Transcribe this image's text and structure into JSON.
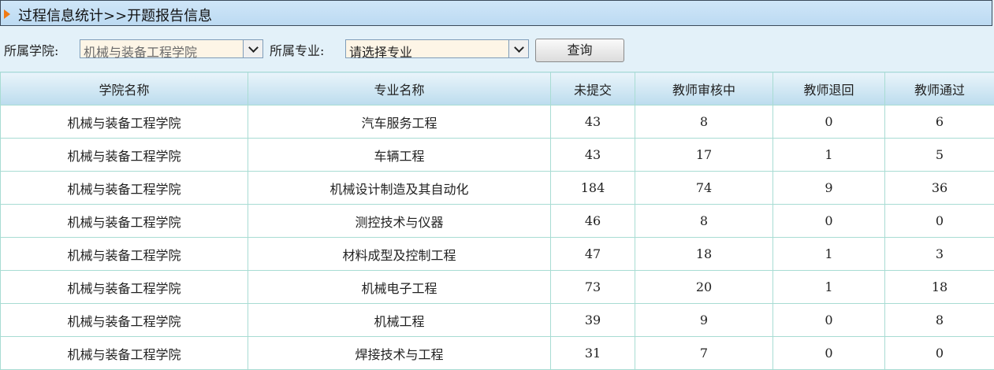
{
  "header": {
    "title": "过程信息统计>>开题报告信息"
  },
  "filters": {
    "college_label": "所属学院:",
    "college_value": "机械与装备工程学院",
    "major_label": "所属专业:",
    "major_value": "请选择专业",
    "query_label": "查询"
  },
  "table": {
    "columns": [
      "学院名称",
      "专业名称",
      "未提交",
      "教师审核中",
      "教师退回",
      "教师通过"
    ],
    "rows": [
      [
        "机械与装备工程学院",
        "汽车服务工程",
        "43",
        "8",
        "0",
        "6"
      ],
      [
        "机械与装备工程学院",
        "车辆工程",
        "43",
        "17",
        "1",
        "5"
      ],
      [
        "机械与装备工程学院",
        "机械设计制造及其自动化",
        "184",
        "74",
        "9",
        "36"
      ],
      [
        "机械与装备工程学院",
        "测控技术与仪器",
        "46",
        "8",
        "0",
        "0"
      ],
      [
        "机械与装备工程学院",
        "材料成型及控制工程",
        "47",
        "18",
        "1",
        "3"
      ],
      [
        "机械与装备工程学院",
        "机械电子工程",
        "73",
        "20",
        "1",
        "18"
      ],
      [
        "机械与装备工程学院",
        "机械工程",
        "39",
        "9",
        "0",
        "8"
      ],
      [
        "机械与装备工程学院",
        "焊接技术与工程",
        "31",
        "7",
        "0",
        "0"
      ]
    ]
  }
}
